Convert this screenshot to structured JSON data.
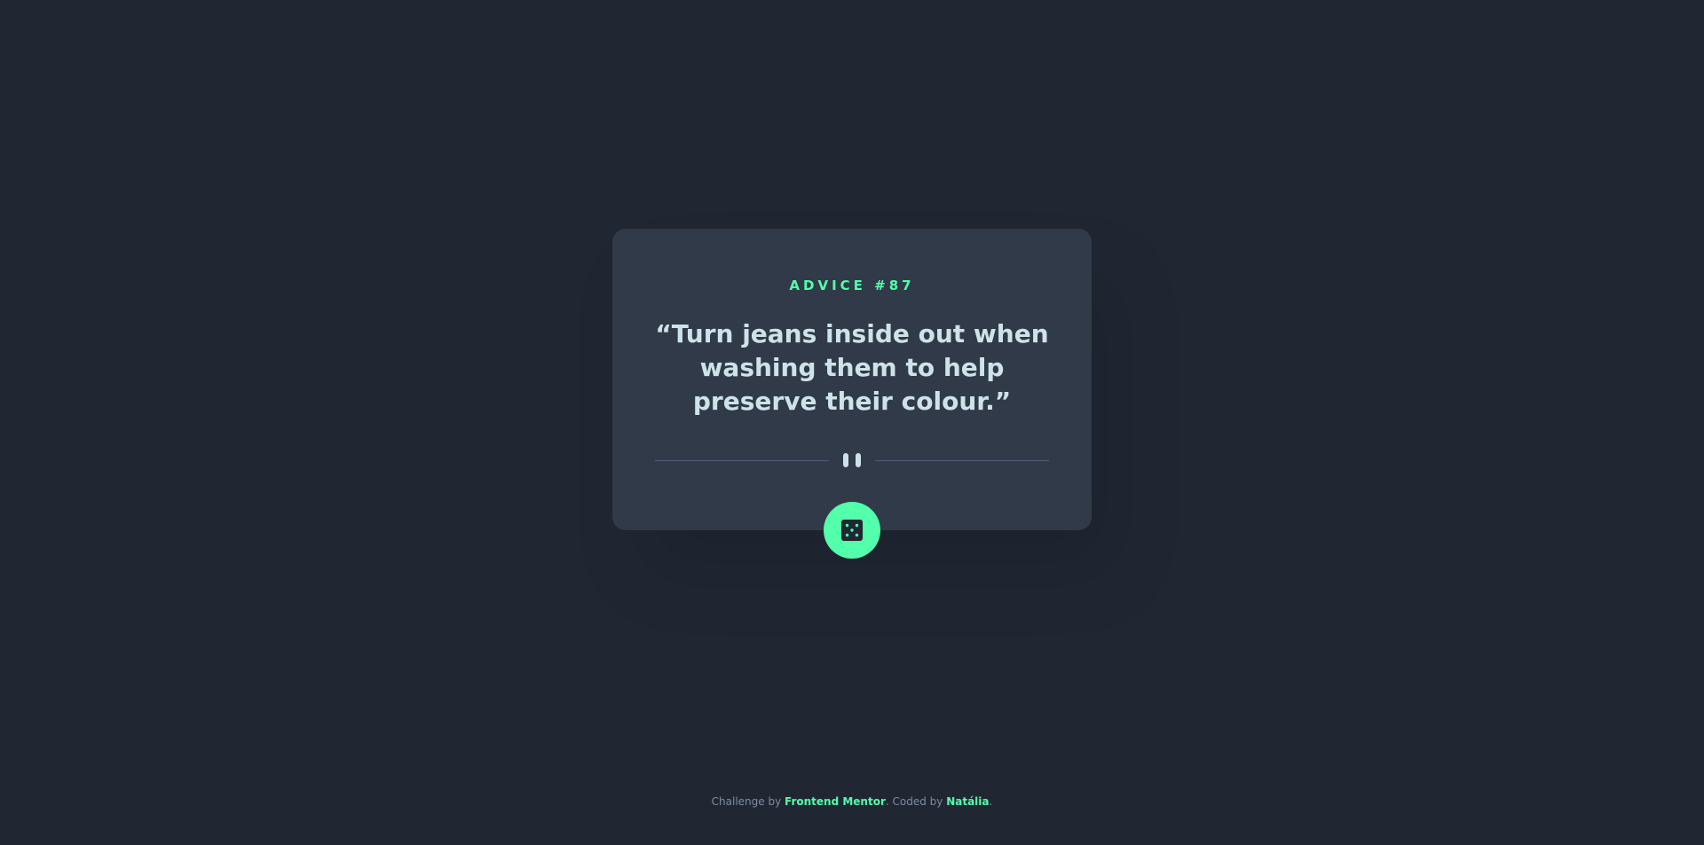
{
  "card": {
    "advice_label": "ADVICE #87",
    "quote": "“Turn jeans inside out when washing them to help preserve their colour.”"
  },
  "icons": {
    "divider": "pause-icon",
    "button": "dice-icon"
  },
  "footer": {
    "prefix": "Challenge by",
    "link1": "Frontend Mentor",
    "middle": ". Coded by",
    "link2": "Natália",
    "suffix": "."
  },
  "colors": {
    "background": "#202733",
    "card": "#313a48",
    "accent": "#53ffaa",
    "text": "#cee3e9",
    "divider": "#4f5d74"
  }
}
